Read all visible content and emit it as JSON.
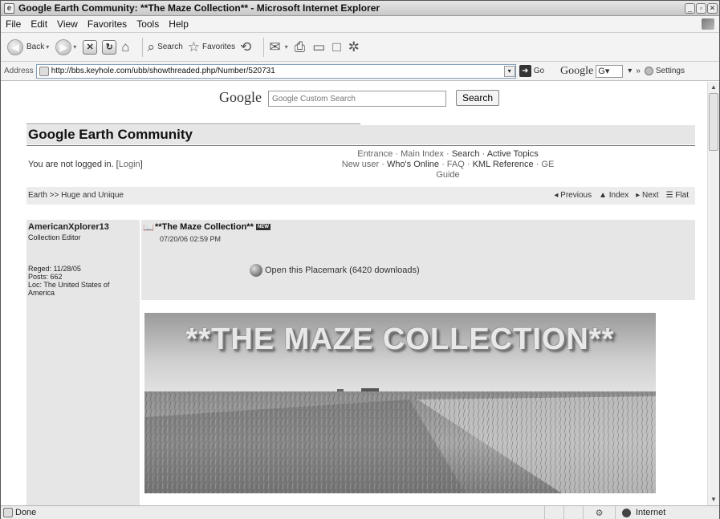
{
  "window": {
    "title": "Google Earth Community: **The Maze Collection** - Microsoft Internet Explorer"
  },
  "menu": [
    "File",
    "Edit",
    "View",
    "Favorites",
    "Tools",
    "Help"
  ],
  "toolbar": {
    "back": "Back",
    "search": "Search",
    "favorites": "Favorites"
  },
  "address": {
    "label": "Address",
    "url": "http://bbs.keyhole.com/ubb/showthreaded.php/Number/520731",
    "go": "Go",
    "google_label": "Google",
    "google_box": "G",
    "more": "»",
    "settings": "Settings"
  },
  "page": {
    "search": {
      "logo": "Google",
      "placeholder": "Google Custom Search",
      "button": "Search"
    },
    "banner": "Google Earth Community",
    "login": {
      "prefix": "You are not logged in. [",
      "link": "Login",
      "suffix": "]"
    },
    "nav": {
      "line1": [
        "Entrance",
        "Main Index",
        "Search",
        "Active Topics"
      ],
      "line2": [
        "New user",
        "Who's Online",
        "FAQ",
        "KML Reference",
        "GE Guide"
      ]
    },
    "breadcrumb": "Earth >> Huge and Unique",
    "post_nav": {
      "previous": "◂ Previous",
      "index": "▲ Index",
      "next": "▸ Next",
      "flat": "☰ Flat"
    },
    "user": {
      "name": "AmericanXplorer13",
      "role": "Collection Editor",
      "reged": "Reged: 11/28/05",
      "posts": "Posts: 662",
      "loc": "Loc: The United States of America"
    },
    "post": {
      "title": "**The Maze Collection**",
      "badge": "NEW",
      "date": "07/20/06 02:59 PM",
      "placemark": "Open this Placemark (6420 downloads)"
    },
    "image_title": "**THE MAZE COLLECTION**"
  },
  "status": {
    "text": "Done",
    "zone": "Internet"
  }
}
